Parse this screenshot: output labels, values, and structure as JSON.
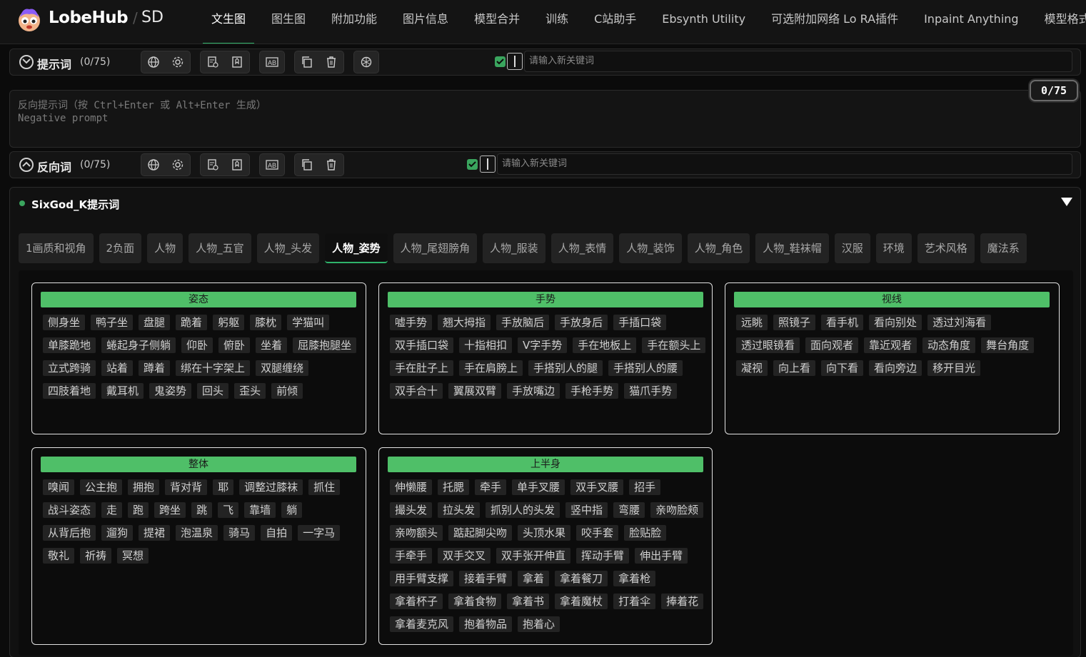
{
  "brand": {
    "name": "LobeHub",
    "sub": "SD"
  },
  "tabs": [
    "文生图",
    "图生图",
    "附加功能",
    "图片信息",
    "模型合并",
    "训练",
    "C站助手",
    "Ebsynth Utility",
    "可选附加网络 Lo RA插件",
    "Inpaint Anything",
    "模型格式"
  ],
  "prompt_row": {
    "label": "提示词",
    "count": "(0/75)",
    "keyword_placeholder": "请输入新关键词"
  },
  "negative_area": {
    "placeholder_line1": "反向提示词（按 Ctrl+Enter 或 Alt+Enter 生成）",
    "placeholder_line2": "Negative prompt",
    "counter": "0/75"
  },
  "negative_row": {
    "label": "反向词",
    "count": "(0/75)",
    "keyword_placeholder": "请输入新关键词"
  },
  "panel": {
    "title": "SixGod_K提示词",
    "categories": [
      "1画质和视角",
      "2负面",
      "人物",
      "人物_五官",
      "人物_头发",
      "人物_姿势",
      "人物_尾翅膀角",
      "人物_服装",
      "人物_表情",
      "人物_装饰",
      "人物_角色",
      "人物_鞋袜帽",
      "汉服",
      "环境",
      "艺术风格",
      "魔法系"
    ],
    "active_category": "人物_姿势",
    "cards": [
      {
        "title": "姿态",
        "chips": [
          "侧身坐",
          "鸭子坐",
          "盘腿",
          "跪着",
          "躬躯",
          "膝枕",
          "学猫叫",
          "单膝跪地",
          "蜷起身子侧躺",
          "仰卧",
          "俯卧",
          "坐着",
          "屈膝抱腿坐",
          "立式跨骑",
          "站着",
          "蹲着",
          "绑在十字架上",
          "双腿缠绕",
          "四肢着地",
          "戴耳机",
          "鬼姿势",
          "回头",
          "歪头",
          "前倾"
        ]
      },
      {
        "title": "手势",
        "chips": [
          "嘘手势",
          "翘大拇指",
          "手放脑后",
          "手放身后",
          "手插口袋",
          "双手插口袋",
          "十指相扣",
          "V字手势",
          "手在地板上",
          "手在额头上",
          "手在肚子上",
          "手在肩膀上",
          "手搭别人的腿",
          "手搭别人的腰",
          "双手合十",
          "翼展双臂",
          "手放嘴边",
          "手枪手势",
          "猫爪手势"
        ]
      },
      {
        "title": "视线",
        "chips": [
          "远眺",
          "照镜子",
          "看手机",
          "看向别处",
          "透过刘海看",
          "透过眼镜看",
          "面向观者",
          "靠近观者",
          "动态角度",
          "舞台角度",
          "凝视",
          "向上看",
          "向下看",
          "看向旁边",
          "移开目光"
        ]
      },
      {
        "title": "整体",
        "chips": [
          "嗅闻",
          "公主抱",
          "拥抱",
          "背对背",
          "耶",
          "调整过膝袜",
          "抓住",
          "战斗姿态",
          "走",
          "跑",
          "跨坐",
          "跳",
          "飞",
          "靠墙",
          "躺",
          "从背后抱",
          "遛狗",
          "提裙",
          "泡温泉",
          "骑马",
          "自拍",
          "一字马",
          "敬礼",
          "祈祷",
          "冥想"
        ]
      },
      {
        "title": "上半身",
        "chips": [
          "伸懒腰",
          "托腮",
          "牵手",
          "单手叉腰",
          "双手叉腰",
          "招手",
          "撮头发",
          "拉头发",
          "抓别人的头发",
          "竖中指",
          "弯腰",
          "亲吻脸颊",
          "亲吻额头",
          "踮起脚尖吻",
          "头顶水果",
          "咬手套",
          "脸贴脸",
          "手牵手",
          "双手交叉",
          "双手张开伸直",
          "挥动手臂",
          "伸出手臂",
          "用手臂支撑",
          "接着手臂",
          "拿着",
          "拿着餐刀",
          "拿着枪",
          "拿着杯子",
          "拿着食物",
          "拿着书",
          "拿着魔杖",
          "打着伞",
          "捧着花",
          "拿着麦克风",
          "抱着物品",
          "抱着心"
        ]
      }
    ]
  },
  "colors": {
    "accent": "#2fb36b",
    "card_header": "#4fbf68",
    "checkbox": "#3aa55e"
  }
}
